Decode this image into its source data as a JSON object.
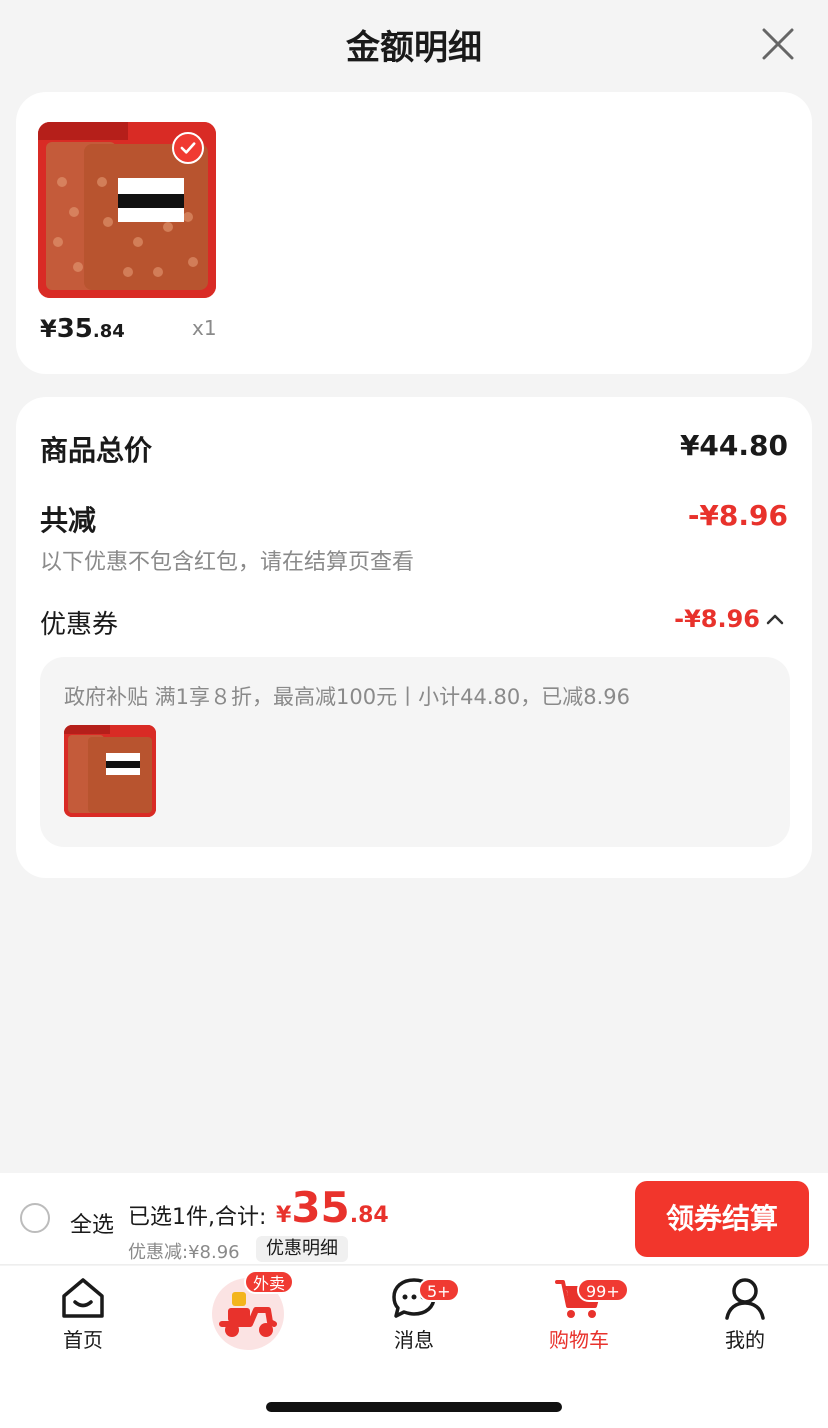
{
  "header": {
    "title": "金额明细"
  },
  "product": {
    "price_symbol": "¥",
    "price_int": "35",
    "price_dec": ".84",
    "qty": "x1"
  },
  "summary": {
    "total_label": "商品总价",
    "total_value": "¥44.80",
    "reduce_label": "共减",
    "reduce_value": "-¥8.96",
    "note": "以下优惠不包含红包，请在结算页查看",
    "coupon_label": "优惠券",
    "coupon_value": "-¥8.96",
    "subsidy_text": "政府补贴 满1享８折，最高减100元丨小计44.80，已减8.96"
  },
  "bottom": {
    "select_all": "全选",
    "selected_text": "已选1件,合计:",
    "total_symbol": "¥",
    "total_int": "35",
    "total_dec": ".84",
    "discount_text": "优惠减:¥8.96",
    "detail_label": "优惠明细",
    "checkout_label": "领券结算"
  },
  "tabbar": {
    "home": "首页",
    "delivery_badge": "外卖",
    "messages": "消息",
    "messages_badge": "5+",
    "cart": "购物车",
    "cart_badge": "99+",
    "mine": "我的"
  },
  "colors": {
    "accent": "#e8322c",
    "button": "#f2362c"
  }
}
